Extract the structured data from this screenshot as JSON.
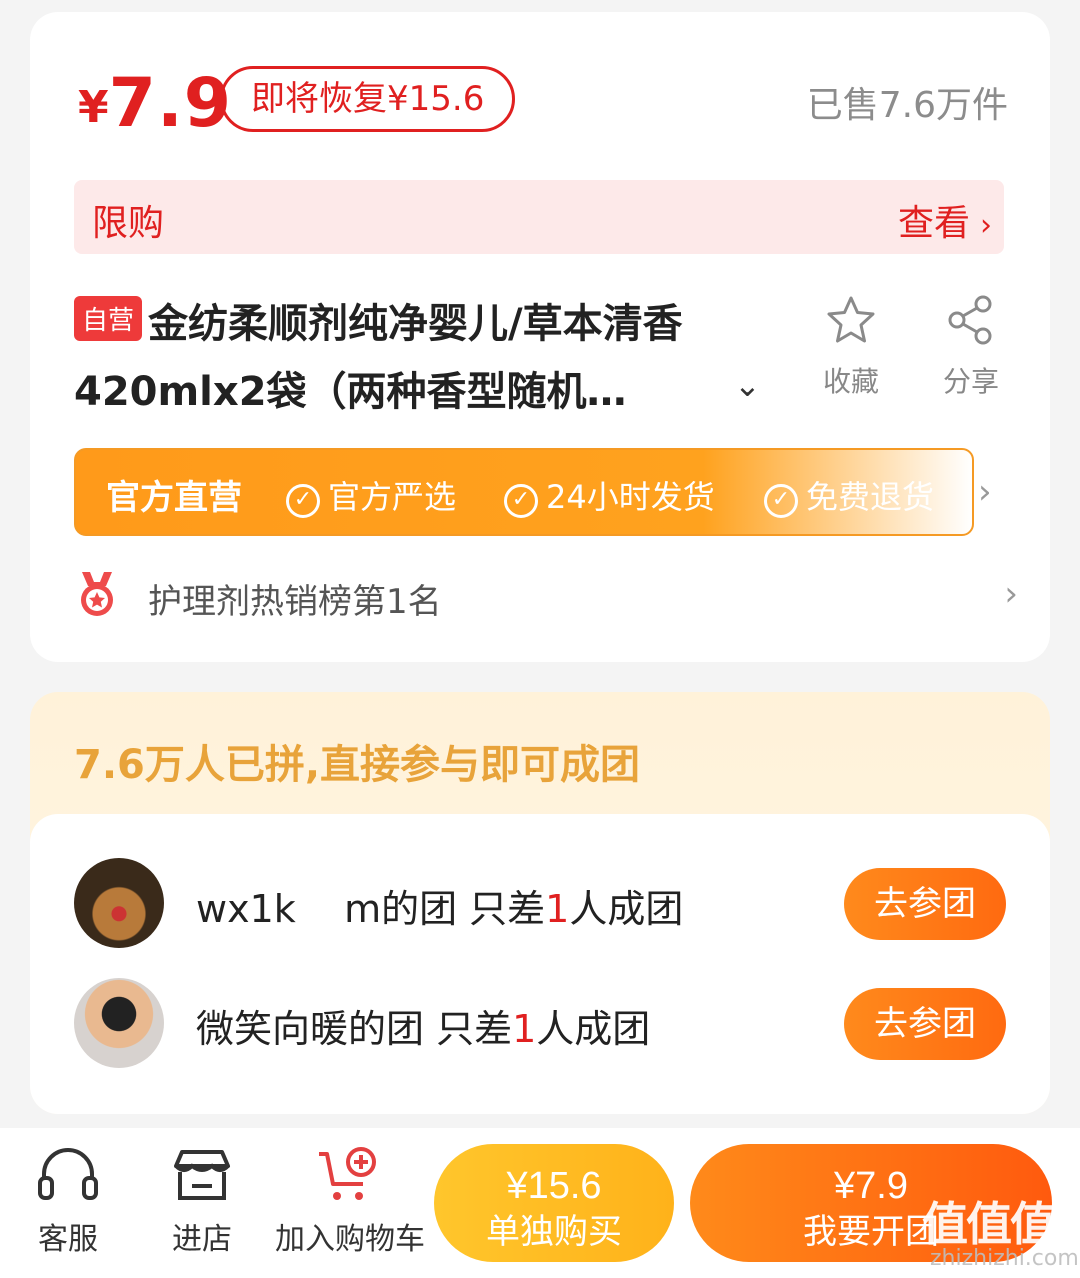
{
  "price": {
    "currency": "¥",
    "value": "7.9",
    "restore": "即将恢复¥15.6",
    "sold": "已售7.6万件"
  },
  "limit": {
    "label": "限购",
    "view": "查看"
  },
  "product": {
    "tag": "自营",
    "title": "金纺柔顺剂纯净婴儿/草本清香420mlx2袋（两种香型随机…",
    "favorite_label": "收藏",
    "share_label": "分享"
  },
  "services": {
    "official": "官方直营",
    "items": [
      "官方严选",
      "24小时发货",
      "免费退货"
    ]
  },
  "rank": {
    "text": "护理剂热销榜第1名"
  },
  "group": {
    "headline": "7.6万人已拼,直接参与即可成团",
    "rows": [
      {
        "name": "wx1k    m的团 只差",
        "count": "1",
        "suffix": "人成团",
        "button": "去参团"
      },
      {
        "name": "微笑向暖的团 只差",
        "count": "1",
        "suffix": "人成团",
        "button": "去参团"
      }
    ]
  },
  "bottom": {
    "service": "客服",
    "store": "进店",
    "cart": "加入购物车",
    "buy_alone_price": "¥15.6",
    "buy_alone_label": "单独购买",
    "buy_group_price": "¥7.9",
    "buy_group_label": "我要开团"
  },
  "watermark": {
    "main": "值值值",
    "sub": "zhizhizhi.com"
  },
  "colors": {
    "accent_red": "#e02020",
    "orange": "#ff8a1a",
    "gold": "#e8a33a"
  }
}
